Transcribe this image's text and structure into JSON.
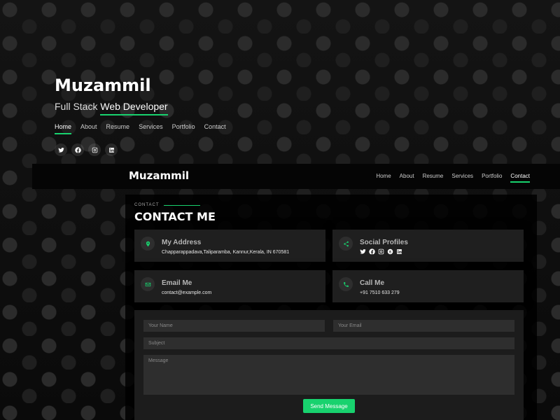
{
  "hero": {
    "name": "Muzammil",
    "subtitle_prefix": "Full Stack ",
    "subtitle_highlight": "Web Developer",
    "nav": [
      "Home",
      "About",
      "Resume",
      "Services",
      "Portfolio",
      "Contact"
    ],
    "active_nav": "Home",
    "social_icons": [
      "twitter-icon",
      "facebook-icon",
      "instagram-icon",
      "linkedin-icon"
    ]
  },
  "header": {
    "brand": "Muzammil",
    "nav": [
      "Home",
      "About",
      "Resume",
      "Services",
      "Portfolio",
      "Contact"
    ],
    "active_nav": "Contact"
  },
  "contact": {
    "section_label": "CONTACT",
    "title": "CONTACT ME",
    "cards": {
      "address": {
        "title": "My Address",
        "value": "Chapparappadava,Taliparamba, Kannur,Kerala, IN 670581",
        "icon": "map-pin-icon"
      },
      "social": {
        "title": "Social Profiles",
        "icon": "share-icon",
        "icons": [
          "twitter-icon",
          "facebook-icon",
          "instagram-icon",
          "skype-icon",
          "linkedin-icon"
        ]
      },
      "email": {
        "title": "Email Me",
        "value": "contact@example.com",
        "icon": "envelope-icon"
      },
      "phone": {
        "title": "Call Me",
        "value": "+91 7510 633 279",
        "icon": "phone-icon"
      }
    },
    "form": {
      "name_placeholder": "Your Name",
      "email_placeholder": "Your Email",
      "subject_placeholder": "Subject",
      "message_placeholder": "Message",
      "submit_label": "Send Message"
    }
  },
  "colors": {
    "accent": "#18d26e",
    "background": "#0d0d0d",
    "card": "#1f1f1f"
  }
}
